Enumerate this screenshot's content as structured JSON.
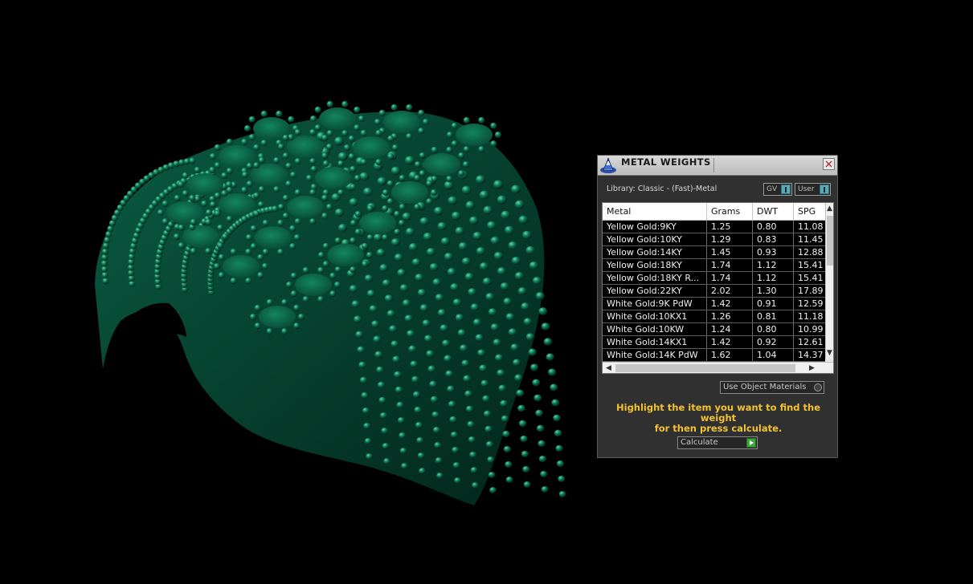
{
  "panel": {
    "title": "METAL WEIGHTS",
    "library_label": "Library: Classic - (Fast)-Metal",
    "gv_label": "GV",
    "user_label": "User",
    "use_object_materials_label": "Use Object Materials",
    "hint_line1": "Highlight the item you want to find the weight",
    "hint_line2": "for then press calculate.",
    "calculate_label": "Calculate"
  },
  "table": {
    "headers": [
      "Metal",
      "Grams",
      "DWT",
      "SPG"
    ],
    "rows": [
      [
        "Yellow Gold:9KY",
        "1.25",
        "0.80",
        "11.08"
      ],
      [
        "Yellow Gold:10KY",
        "1.29",
        "0.83",
        "11.45"
      ],
      [
        "Yellow Gold:14KY",
        "1.45",
        "0.93",
        "12.88"
      ],
      [
        "Yellow Gold:18KY",
        "1.74",
        "1.12",
        "15.41"
      ],
      [
        "Yellow Gold:18KY R...",
        "1.74",
        "1.12",
        "15.41"
      ],
      [
        "Yellow Gold:22KY",
        "2.02",
        "1.30",
        "17.89"
      ],
      [
        "White Gold:9K PdW",
        "1.42",
        "0.91",
        "12.59"
      ],
      [
        "White Gold:10KX1",
        "1.26",
        "0.81",
        "11.18"
      ],
      [
        "White Gold:10KW",
        "1.24",
        "0.80",
        "10.99"
      ],
      [
        "White Gold:14KX1",
        "1.42",
        "0.92",
        "12.61"
      ],
      [
        "White Gold:14K PdW",
        "1.62",
        "1.04",
        "14.37"
      ]
    ]
  },
  "colors": {
    "background": "#000000",
    "model_green": "#0d6b4e",
    "hint_yellow": "#f2c230",
    "panel_bg": "#303030"
  }
}
